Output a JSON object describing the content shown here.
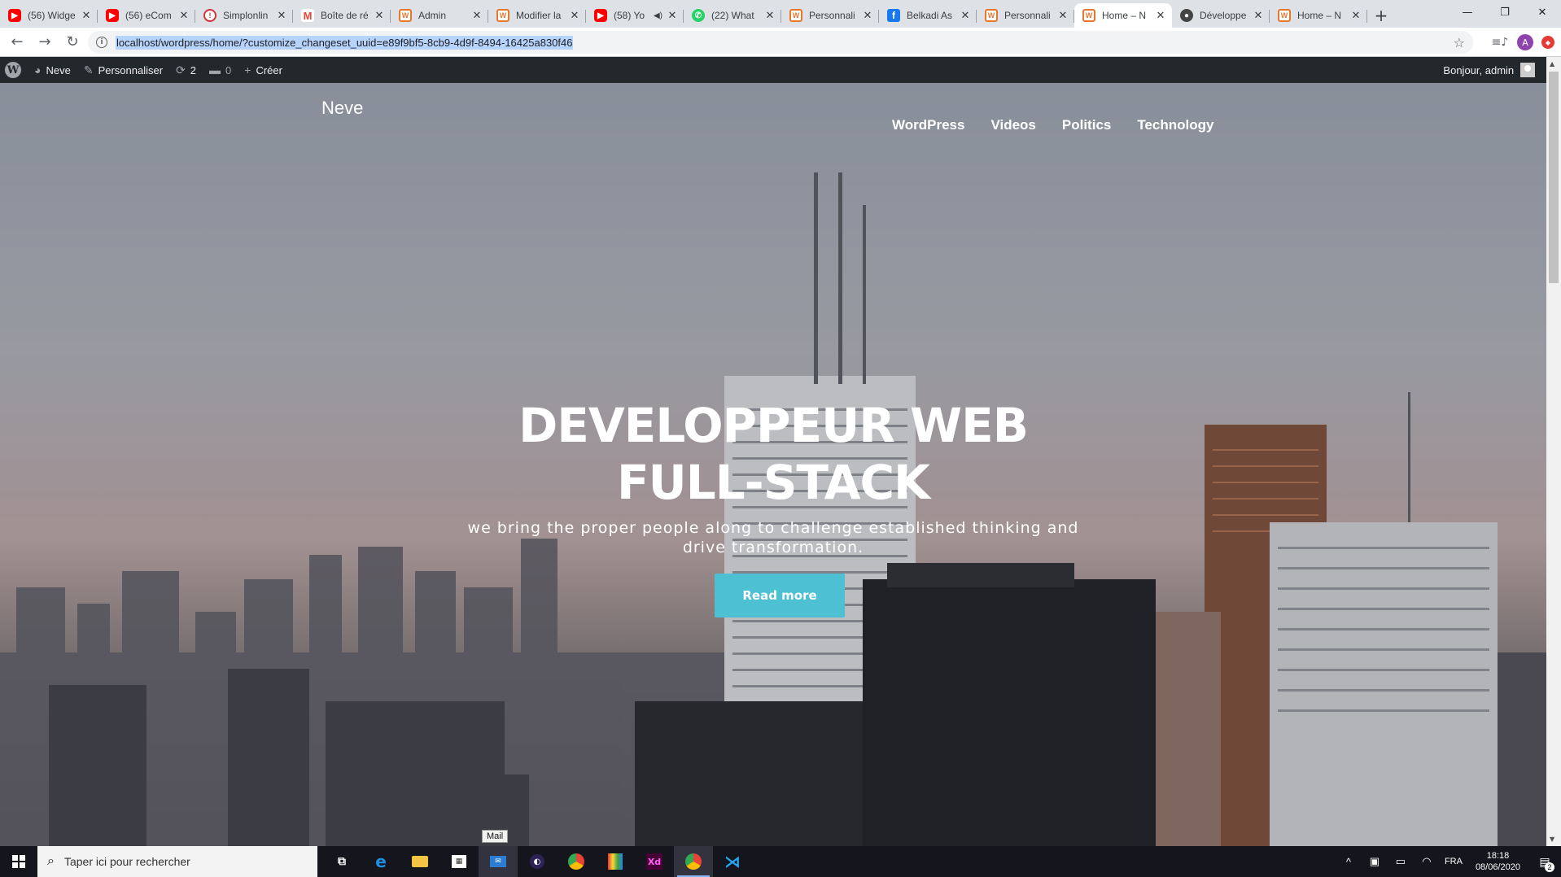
{
  "browser": {
    "tabs": [
      {
        "label": "(56) Widge",
        "icon": "youtube-icon"
      },
      {
        "label": "(56) eCom",
        "icon": "youtube-icon"
      },
      {
        "label": "Simplonlin",
        "icon": "simplon-icon"
      },
      {
        "label": "Boîte de ré",
        "icon": "gmail-icon"
      },
      {
        "label": "Admin",
        "icon": "wordpress-site-icon"
      },
      {
        "label": "Modifier la",
        "icon": "wordpress-site-icon"
      },
      {
        "label": "(58) Yo",
        "icon": "youtube-icon"
      },
      {
        "label": "(22) What",
        "icon": "whatsapp-icon"
      },
      {
        "label": "Personnali",
        "icon": "wordpress-site-icon"
      },
      {
        "label": "Belkadi As",
        "icon": "facebook-icon"
      },
      {
        "label": "Personnali",
        "icon": "wordpress-site-icon"
      },
      {
        "label": "Home – N",
        "icon": "wordpress-site-icon"
      },
      {
        "label": "Développe",
        "icon": "github-icon"
      },
      {
        "label": "Home – N",
        "icon": "wordpress-site-icon"
      }
    ],
    "active_tab_index": 11,
    "url": "localhost/wordpress/home/?customize_changeset_uuid=e89f9bf5-8cb9-4d9f-8494-16425a830f46"
  },
  "adminbar": {
    "site_name": "Neve",
    "customize": "Personnaliser",
    "updates_count": "2",
    "comments_count": "0",
    "new": "Créer",
    "greeting": "Bonjour, admin"
  },
  "site": {
    "title": "Neve",
    "menu": [
      "WordPress",
      "Videos",
      "Politics",
      "Technology"
    ],
    "hero_title": "DEVELOPPEUR WEB FULL-STACK",
    "hero_subtitle": "we bring the proper people along to challenge established thinking and drive transformation.",
    "hero_button": "Read more",
    "button_color": "#4ec0d4"
  },
  "taskbar": {
    "search_placeholder": "Taper ici pour rechercher",
    "tooltip": "Mail",
    "language": "FRA",
    "time": "18:18",
    "date": "08/06/2020",
    "notifications": "2"
  }
}
